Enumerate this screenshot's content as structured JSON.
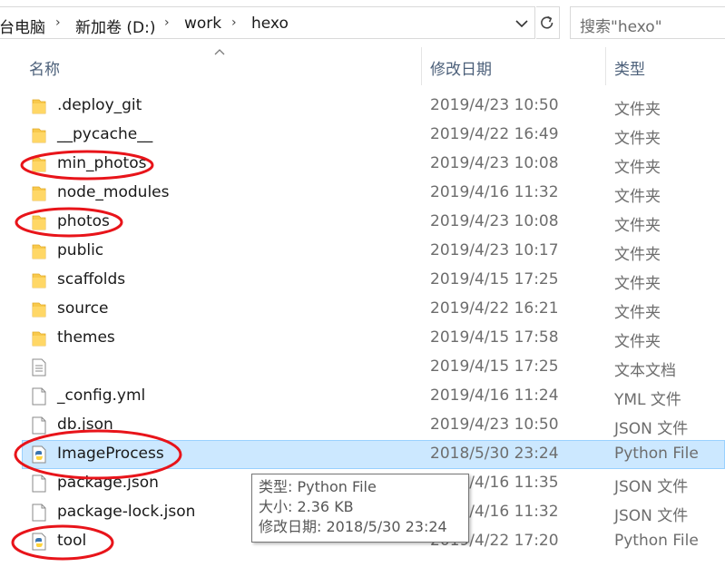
{
  "address_bar": {
    "crumbs": [
      "台电脑",
      "新加卷 (D:)",
      "work",
      "hexo"
    ]
  },
  "search": {
    "placeholder": "搜索\"hexo\""
  },
  "columns": {
    "name": "名称",
    "modified": "修改日期",
    "type": "类型"
  },
  "files": [
    {
      "name": ".deploy_git",
      "modified": "2019/4/23 10:50",
      "type": "文件夹",
      "icon": "folder-icon"
    },
    {
      "name": "__pycache__",
      "modified": "2019/4/22 16:49",
      "type": "文件夹",
      "icon": "folder-icon"
    },
    {
      "name": "min_photos",
      "modified": "2019/4/23 10:08",
      "type": "文件夹",
      "icon": "folder-icon"
    },
    {
      "name": "node_modules",
      "modified": "2019/4/16 11:32",
      "type": "文件夹",
      "icon": "folder-icon"
    },
    {
      "name": "photos",
      "modified": "2019/4/23 10:08",
      "type": "文件夹",
      "icon": "folder-icon"
    },
    {
      "name": "public",
      "modified": "2019/4/23 10:17",
      "type": "文件夹",
      "icon": "folder-icon"
    },
    {
      "name": "scaffolds",
      "modified": "2019/4/15 17:25",
      "type": "文件夹",
      "icon": "folder-icon"
    },
    {
      "name": "source",
      "modified": "2019/4/22 16:21",
      "type": "文件夹",
      "icon": "folder-icon"
    },
    {
      "name": "themes",
      "modified": "2019/4/15 17:58",
      "type": "文件夹",
      "icon": "folder-icon"
    },
    {
      "name": "",
      "modified": "2019/4/15 17:25",
      "type": "文本文档",
      "icon": "text-file-icon"
    },
    {
      "name": "_config.yml",
      "modified": "2019/4/16 11:24",
      "type": "YML 文件",
      "icon": "file-icon"
    },
    {
      "name": "db.json",
      "modified": "2019/4/23 10:50",
      "type": "JSON 文件",
      "icon": "file-icon"
    },
    {
      "name": "ImageProcess",
      "modified": "2018/5/30 23:24",
      "type": "Python File",
      "icon": "python-file-icon",
      "selected": true
    },
    {
      "name": "package.json",
      "modified": "2019/4/16 11:35",
      "type": "JSON 文件",
      "icon": "file-icon"
    },
    {
      "name": "package-lock.json",
      "modified": "2019/4/16 11:32",
      "type": "JSON 文件",
      "icon": "file-icon"
    },
    {
      "name": "tool",
      "modified": "2019/4/22 17:20",
      "type": "Python File",
      "icon": "python-file-icon"
    }
  ],
  "tooltip": {
    "type_line": "类型: Python File",
    "size_line": "大小: 2.36 KB",
    "modified_line": "修改日期: 2018/5/30 23:24"
  },
  "colors": {
    "selection_bg": "#cce8ff",
    "selection_border": "#99d1ff",
    "annotation_red": "#e8141a",
    "folder_yellow": "#f8c94c"
  }
}
